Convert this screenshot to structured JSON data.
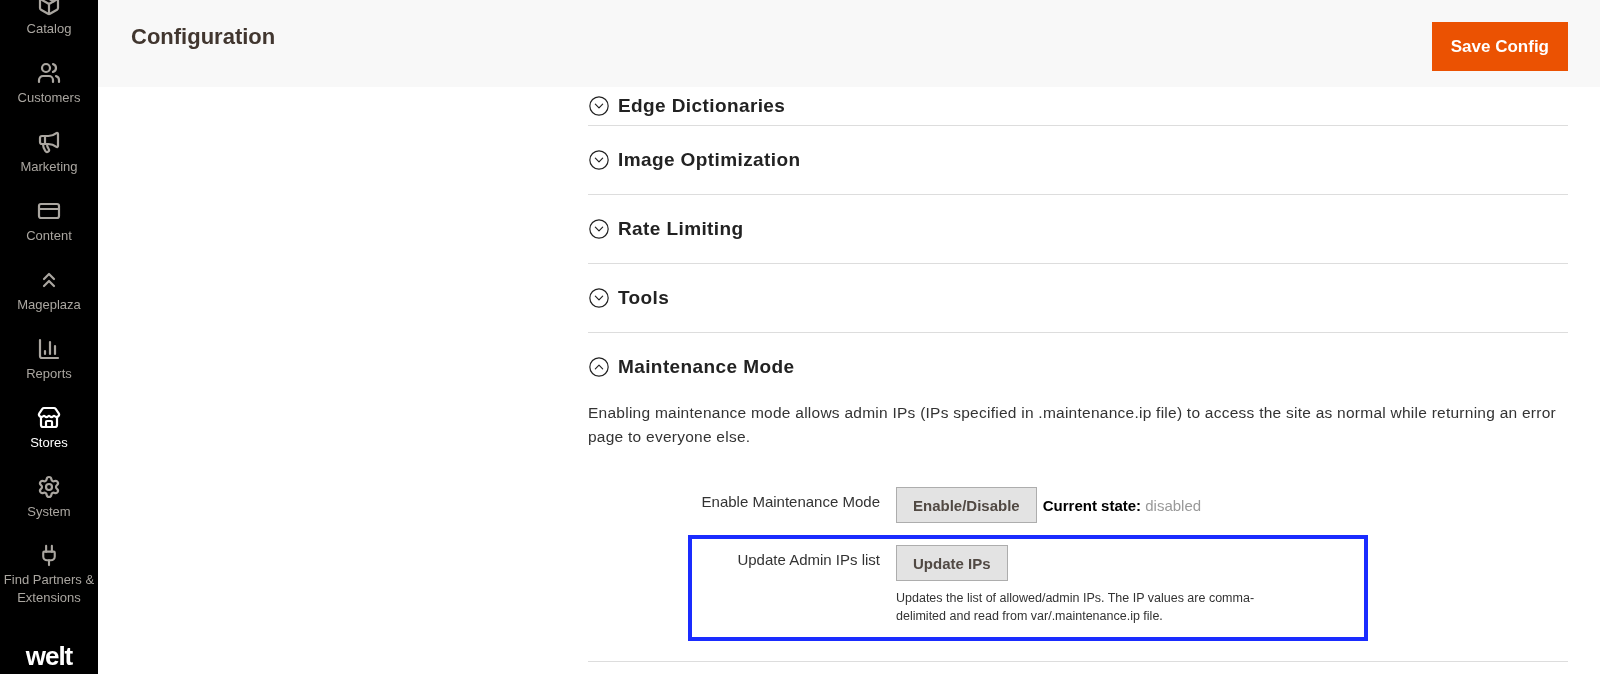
{
  "sidebar": {
    "items": [
      {
        "label": "Catalog",
        "selected": false
      },
      {
        "label": "Customers",
        "selected": false
      },
      {
        "label": "Marketing",
        "selected": false
      },
      {
        "label": "Content",
        "selected": false
      },
      {
        "label": "Mageplaza",
        "selected": false
      },
      {
        "label": "Reports",
        "selected": false
      },
      {
        "label": "Stores",
        "selected": true
      },
      {
        "label": "System",
        "selected": false
      },
      {
        "label": "Find Partners & Extensions",
        "selected": false
      }
    ],
    "logo": "welt"
  },
  "header": {
    "title": "Configuration",
    "save_button": "Save Config"
  },
  "sections": [
    {
      "title": "Edge Dictionaries",
      "expanded": false
    },
    {
      "title": "Image Optimization",
      "expanded": false
    },
    {
      "title": "Rate Limiting",
      "expanded": false
    },
    {
      "title": "Tools",
      "expanded": false
    },
    {
      "title": "Maintenance Mode",
      "expanded": true,
      "description": "Enabling maintenance mode allows admin IPs (IPs specified in .maintenance.ip file) to access the site as normal while returning an error page to everyone else.",
      "fields": [
        {
          "label": "Enable Maintenance Mode",
          "button": "Enable/Disable",
          "status_label": "Current state:",
          "status_value": "disabled",
          "highlighted": false
        },
        {
          "label": "Update Admin IPs list",
          "button": "Update IPs",
          "note": "Updates the list of allowed/admin IPs. The IP values are comma-delimited and read from var/.maintenance.ip file.",
          "highlighted": true
        }
      ]
    }
  ]
}
